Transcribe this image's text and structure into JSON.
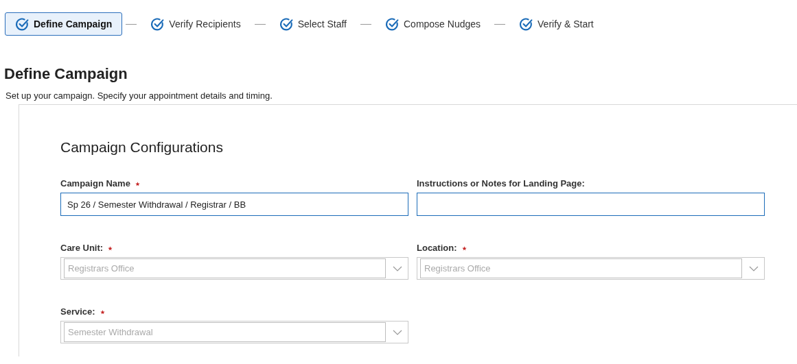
{
  "steps": [
    {
      "label": "Define Campaign",
      "selected": true
    },
    {
      "label": "Verify Recipients",
      "selected": false
    },
    {
      "label": "Select Staff",
      "selected": false
    },
    {
      "label": "Compose Nudges",
      "selected": false
    },
    {
      "label": "Verify & Start",
      "selected": false
    }
  ],
  "page": {
    "title": "Define Campaign",
    "subtitle": "Set up your campaign. Specify your appointment details and timing."
  },
  "card": {
    "title": "Campaign Configurations",
    "fields": [
      {
        "kind": "text",
        "label": "Campaign Name",
        "required": true,
        "value": "Sp 26 / Semester Withdrawal / Registrar / BB"
      },
      {
        "kind": "text",
        "label": "Instructions or Notes for Landing Page:",
        "required": false
      },
      {
        "kind": "select",
        "label": "Care Unit:",
        "required": true,
        "value": "Registrars Office",
        "disabled": true
      },
      {
        "kind": "select",
        "label": "Location:",
        "required": true,
        "value": "Registrars Office",
        "disabled": true
      },
      {
        "kind": "select",
        "label": "Service:",
        "required": true,
        "value": "Semester Withdrawal",
        "disabled": true
      }
    ]
  }
}
